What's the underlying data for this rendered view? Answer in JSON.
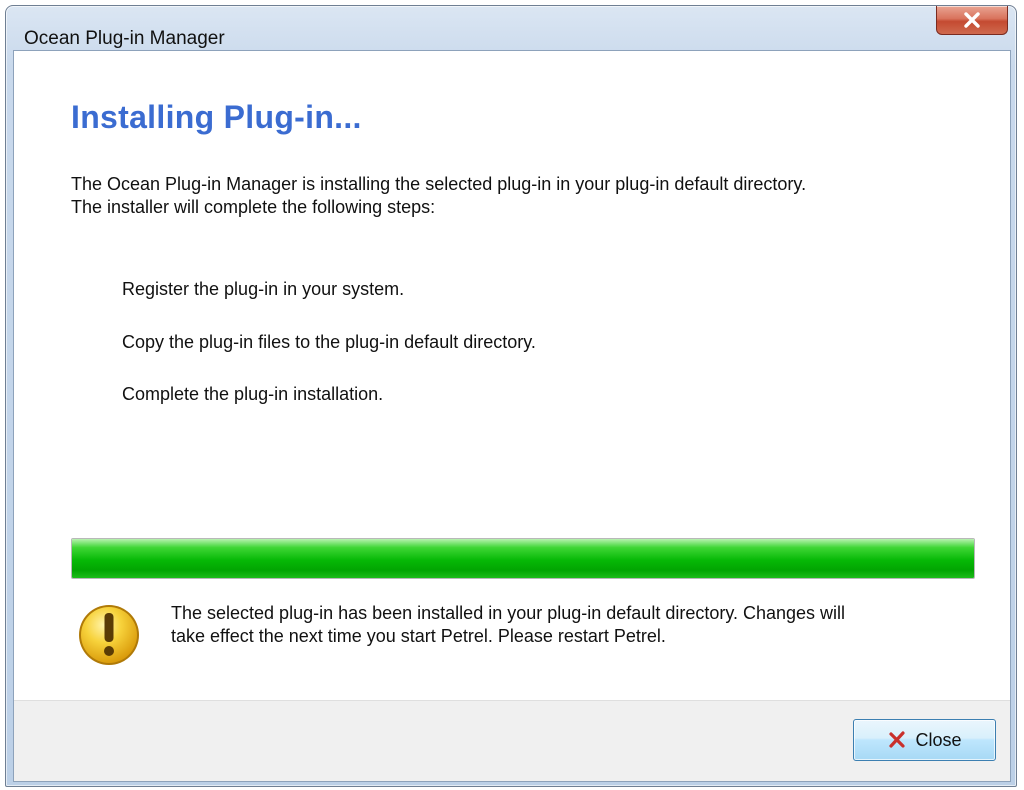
{
  "window": {
    "title": "Ocean Plug-in Manager",
    "close_icon": "close-icon"
  },
  "main": {
    "heading": "Installing Plug-in...",
    "intro_line1": "The Ocean Plug-in Manager is installing the selected plug-in in your plug-in default directory.",
    "intro_line2": "The installer will complete the following steps:",
    "steps": [
      {
        "label": "Register the plug-in in your system."
      },
      {
        "label": "Copy the plug-in files to the plug-in default directory."
      },
      {
        "label": "Complete the plug-in installation."
      }
    ],
    "progress": {
      "value": 1.0,
      "color": "#06b806"
    },
    "warning_icon": "warning-icon",
    "message_line1": "The selected plug-in has been installed in your plug-in default directory. Changes will",
    "message_line2": "take effect the next time you start Petrel. Please restart Petrel."
  },
  "footer": {
    "close_label": "Close",
    "close_button_icon": "red-x-icon"
  },
  "colors": {
    "heading": "#3b6cd1",
    "progress_fill": "#06b806",
    "warning": "#f2c21b",
    "close_x": "#c9302c"
  }
}
